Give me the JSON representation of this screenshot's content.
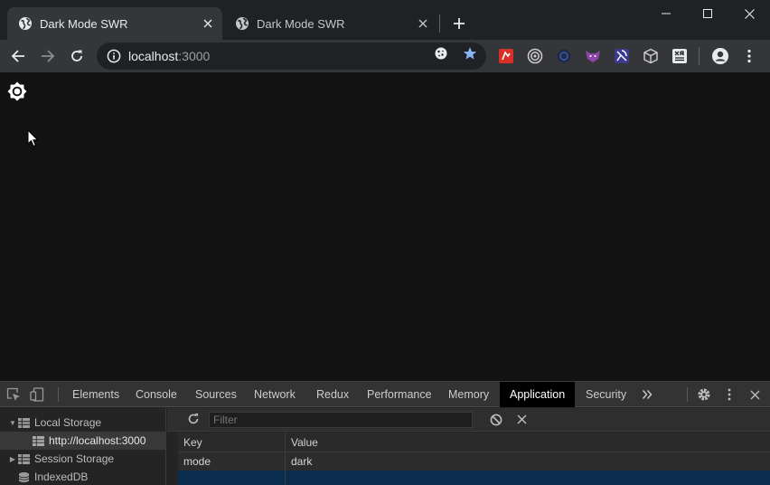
{
  "browser": {
    "tabs": [
      {
        "title": "Dark Mode SWR",
        "active": true
      },
      {
        "title": "Dark Mode SWR",
        "active": false
      }
    ],
    "url_host": "localhost",
    "url_port": ":3000"
  },
  "devtools": {
    "tabs": [
      "Elements",
      "Console",
      "Sources",
      "Network",
      "Redux",
      "Performance",
      "Memory",
      "Application",
      "Security"
    ],
    "active_tab": "Application",
    "sidebar": {
      "local_storage": "Local Storage",
      "local_storage_origin": "http://localhost:3000",
      "session_storage": "Session Storage",
      "indexeddb": "IndexedDB"
    },
    "filter_placeholder": "Filter",
    "table": {
      "headers": {
        "key": "Key",
        "value": "Value"
      },
      "rows": [
        {
          "key": "mode",
          "value": "dark"
        }
      ]
    }
  },
  "colors": {
    "page_bg": "#121212",
    "tab_active_bg": "#35363a",
    "selected_row": "#0b2d4d",
    "bookmark_star": "#8ab4f8"
  }
}
